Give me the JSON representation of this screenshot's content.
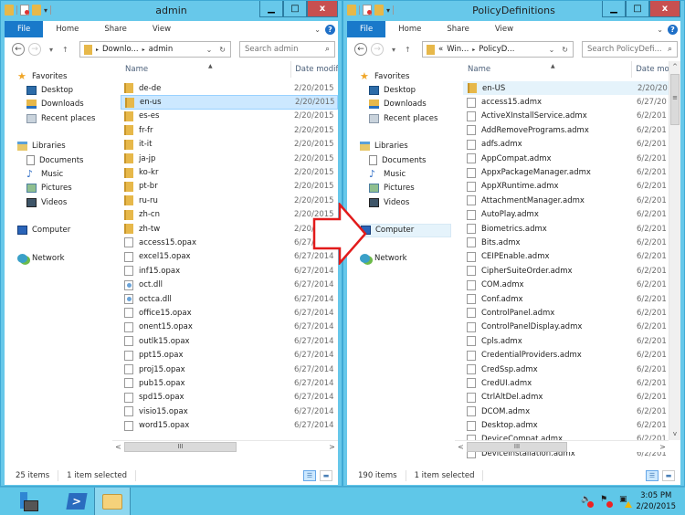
{
  "windows": [
    {
      "title": "admin",
      "ribbon_tabs": [
        "File",
        "Home",
        "Share",
        "View"
      ],
      "address": {
        "prefix": "",
        "crumbs": [
          "Downlo...",
          "admin"
        ]
      },
      "search_placeholder": "Search admin",
      "nav": {
        "favorites": "Favorites",
        "favorites_items": [
          "Desktop",
          "Downloads",
          "Recent places"
        ],
        "libraries": "Libraries",
        "libraries_items": [
          "Documents",
          "Music",
          "Pictures",
          "Videos"
        ],
        "computer": "Computer",
        "network": "Network"
      },
      "columns": {
        "name": "Name",
        "date": "Date modif"
      },
      "files": [
        {
          "name": "de-de",
          "date": "2/20/2015",
          "type": "folder"
        },
        {
          "name": "en-us",
          "date": "2/20/2015",
          "type": "folder",
          "selected": true
        },
        {
          "name": "es-es",
          "date": "2/20/2015",
          "type": "folder"
        },
        {
          "name": "fr-fr",
          "date": "2/20/2015",
          "type": "folder"
        },
        {
          "name": "it-it",
          "date": "2/20/2015",
          "type": "folder"
        },
        {
          "name": "ja-jp",
          "date": "2/20/2015",
          "type": "folder"
        },
        {
          "name": "ko-kr",
          "date": "2/20/2015",
          "type": "folder"
        },
        {
          "name": "pt-br",
          "date": "2/20/2015",
          "type": "folder"
        },
        {
          "name": "ru-ru",
          "date": "2/20/2015",
          "type": "folder"
        },
        {
          "name": "zh-cn",
          "date": "2/20/2015",
          "type": "folder"
        },
        {
          "name": "zh-tw",
          "date": "2/20/2015",
          "type": "folder"
        },
        {
          "name": "access15.opax",
          "date": "6/27/2014",
          "type": "file"
        },
        {
          "name": "excel15.opax",
          "date": "6/27/2014",
          "type": "file"
        },
        {
          "name": "inf15.opax",
          "date": "6/27/2014",
          "type": "file"
        },
        {
          "name": "oct.dll",
          "date": "6/27/2014",
          "type": "dll"
        },
        {
          "name": "octca.dll",
          "date": "6/27/2014",
          "type": "dll"
        },
        {
          "name": "office15.opax",
          "date": "6/27/2014",
          "type": "file"
        },
        {
          "name": "onent15.opax",
          "date": "6/27/2014",
          "type": "file"
        },
        {
          "name": "outlk15.opax",
          "date": "6/27/2014",
          "type": "file"
        },
        {
          "name": "ppt15.opax",
          "date": "6/27/2014",
          "type": "file"
        },
        {
          "name": "proj15.opax",
          "date": "6/27/2014",
          "type": "file"
        },
        {
          "name": "pub15.opax",
          "date": "6/27/2014",
          "type": "file"
        },
        {
          "name": "spd15.opax",
          "date": "6/27/2014",
          "type": "file"
        },
        {
          "name": "visio15.opax",
          "date": "6/27/2014",
          "type": "file"
        },
        {
          "name": "word15.opax",
          "date": "6/27/2014",
          "type": "file"
        }
      ],
      "status": {
        "count": "25 items",
        "selected": "1 item selected"
      }
    },
    {
      "title": "PolicyDefinitions",
      "ribbon_tabs": [
        "File",
        "Home",
        "Share",
        "View"
      ],
      "address": {
        "prefix": "«",
        "crumbs": [
          "Win...",
          "PolicyD..."
        ]
      },
      "search_placeholder": "Search PolicyDefi...",
      "nav": {
        "favorites": "Favorites",
        "favorites_items": [
          "Desktop",
          "Downloads",
          "Recent places"
        ],
        "libraries": "Libraries",
        "libraries_items": [
          "Documents",
          "Music",
          "Pictures",
          "Videos"
        ],
        "computer": "Computer",
        "network": "Network"
      },
      "columns": {
        "name": "Name",
        "date": "Date mo"
      },
      "files": [
        {
          "name": "en-US",
          "date": "2/20/20",
          "type": "folder",
          "hover": true
        },
        {
          "name": "access15.admx",
          "date": "6/27/20",
          "type": "file"
        },
        {
          "name": "ActiveXInstallService.admx",
          "date": "6/2/201",
          "type": "file"
        },
        {
          "name": "AddRemovePrograms.admx",
          "date": "6/2/201",
          "type": "file"
        },
        {
          "name": "adfs.admx",
          "date": "6/2/201",
          "type": "file"
        },
        {
          "name": "AppCompat.admx",
          "date": "6/2/201",
          "type": "file"
        },
        {
          "name": "AppxPackageManager.admx",
          "date": "6/2/201",
          "type": "file"
        },
        {
          "name": "AppXRuntime.admx",
          "date": "6/2/201",
          "type": "file"
        },
        {
          "name": "AttachmentManager.admx",
          "date": "6/2/201",
          "type": "file"
        },
        {
          "name": "AutoPlay.admx",
          "date": "6/2/201",
          "type": "file"
        },
        {
          "name": "Biometrics.admx",
          "date": "6/2/201",
          "type": "file"
        },
        {
          "name": "Bits.admx",
          "date": "6/2/201",
          "type": "file"
        },
        {
          "name": "CEIPEnable.admx",
          "date": "6/2/201",
          "type": "file"
        },
        {
          "name": "CipherSuiteOrder.admx",
          "date": "6/2/201",
          "type": "file"
        },
        {
          "name": "COM.admx",
          "date": "6/2/201",
          "type": "file"
        },
        {
          "name": "Conf.admx",
          "date": "6/2/201",
          "type": "file"
        },
        {
          "name": "ControlPanel.admx",
          "date": "6/2/201",
          "type": "file"
        },
        {
          "name": "ControlPanelDisplay.admx",
          "date": "6/2/201",
          "type": "file"
        },
        {
          "name": "Cpls.admx",
          "date": "6/2/201",
          "type": "file"
        },
        {
          "name": "CredentialProviders.admx",
          "date": "6/2/201",
          "type": "file"
        },
        {
          "name": "CredSsp.admx",
          "date": "6/2/201",
          "type": "file"
        },
        {
          "name": "CredUI.admx",
          "date": "6/2/201",
          "type": "file"
        },
        {
          "name": "CtrlAltDel.admx",
          "date": "6/2/201",
          "type": "file"
        },
        {
          "name": "DCOM.admx",
          "date": "6/2/201",
          "type": "file"
        },
        {
          "name": "Desktop.admx",
          "date": "6/2/201",
          "type": "file"
        },
        {
          "name": "DeviceCompat.admx",
          "date": "6/2/201",
          "type": "file"
        },
        {
          "name": "DeviceInstallation.admx",
          "date": "6/2/201",
          "type": "file"
        }
      ],
      "status": {
        "count": "190 items",
        "selected": "1 item selected"
      }
    }
  ],
  "taskbar": {
    "apps": [
      "Server Manager",
      "Windows PowerShell",
      "File Explorer"
    ],
    "clock_time": "3:05 PM",
    "clock_date": "2/20/2015"
  },
  "glyphs": {
    "back": "←",
    "forward": "→",
    "recent": "▾",
    "up": "↑",
    "crumb_sep": "▸",
    "dropdown": "⌄",
    "refresh": "↻",
    "search": "⌕",
    "minimize": "▁",
    "maximize": "□",
    "close": "x",
    "scroll_left": "<",
    "scroll_right": ">",
    "scroll_up": "^",
    "scroll_down": "v",
    "grip": "III",
    "help": "?",
    "chevron": "⌄",
    "speaker_icon": "🔈",
    "flag_icon": "⚑",
    "network_icon": "▣"
  },
  "colors": {
    "accent": "#1979ca",
    "window_frame": "#67c8ea",
    "selection": "#cce8ff",
    "arrow": "#e21b1b",
    "close": "#c75050"
  }
}
